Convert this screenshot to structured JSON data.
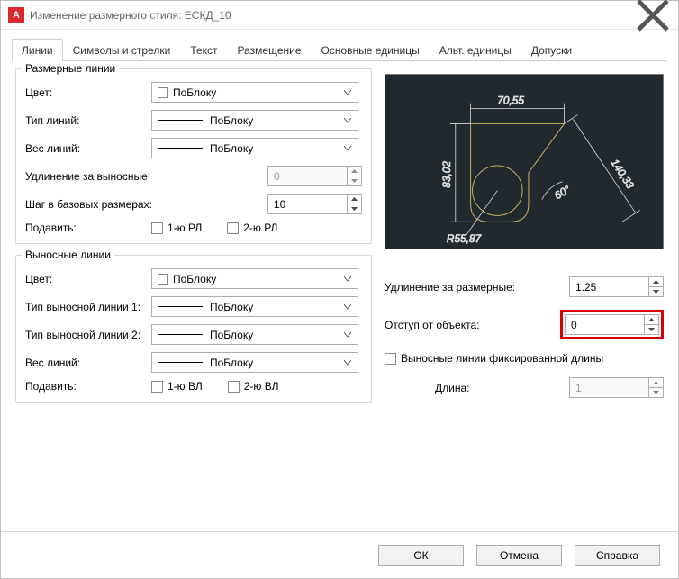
{
  "window": {
    "title": "Изменение размерного стиля: ЕСКД_10"
  },
  "tabs": [
    "Линии",
    "Символы и стрелки",
    "Текст",
    "Размещение",
    "Основные единицы",
    "Альт. единицы",
    "Допуски"
  ],
  "dimLines": {
    "groupLabel": "Размерные линии",
    "colorLabel": "Цвет:",
    "colorValue": "ПоБлоку",
    "ltypeLabel": "Тип линий:",
    "ltypeValue": "ПоБлоку",
    "lweightLabel": "Вес линий:",
    "lweightValue": "ПоБлоку",
    "extendLabel": "Удлинение за выносные:",
    "extendValue": "0",
    "baselineLabel": "Шаг в базовых размерах:",
    "baselineValue": "10",
    "suppressLabel": "Подавить:",
    "sup1": "1-ю РЛ",
    "sup2": "2-ю РЛ"
  },
  "extLines": {
    "groupLabel": "Выносные линии",
    "colorLabel": "Цвет:",
    "colorValue": "ПоБлоку",
    "lt1Label": "Тип выносной линии 1:",
    "lt1Value": "ПоБлоку",
    "lt2Label": "Тип выносной линии 2:",
    "lt2Value": "ПоБлоку",
    "lweightLabel": "Вес линий:",
    "lweightValue": "ПоБлоку",
    "suppressLabel": "Подавить:",
    "sup1": "1-ю ВЛ",
    "sup2": "2-ю ВЛ"
  },
  "right": {
    "extBeyondLabel": "Удлинение за размерные:",
    "extBeyondValue": "1.25",
    "offsetLabel": "Отступ от объекта:",
    "offsetValue": "0",
    "fixedLabel": "Выносные линии фиксированной длины",
    "lengthLabel": "Длина:",
    "lengthValue": "1"
  },
  "preview": {
    "d1": "70,55",
    "d2": "83,02",
    "d3": "140,33",
    "radius": "R55,87",
    "angle": "60°"
  },
  "buttons": {
    "ok": "ОК",
    "cancel": "Отмена",
    "help": "Справка"
  }
}
